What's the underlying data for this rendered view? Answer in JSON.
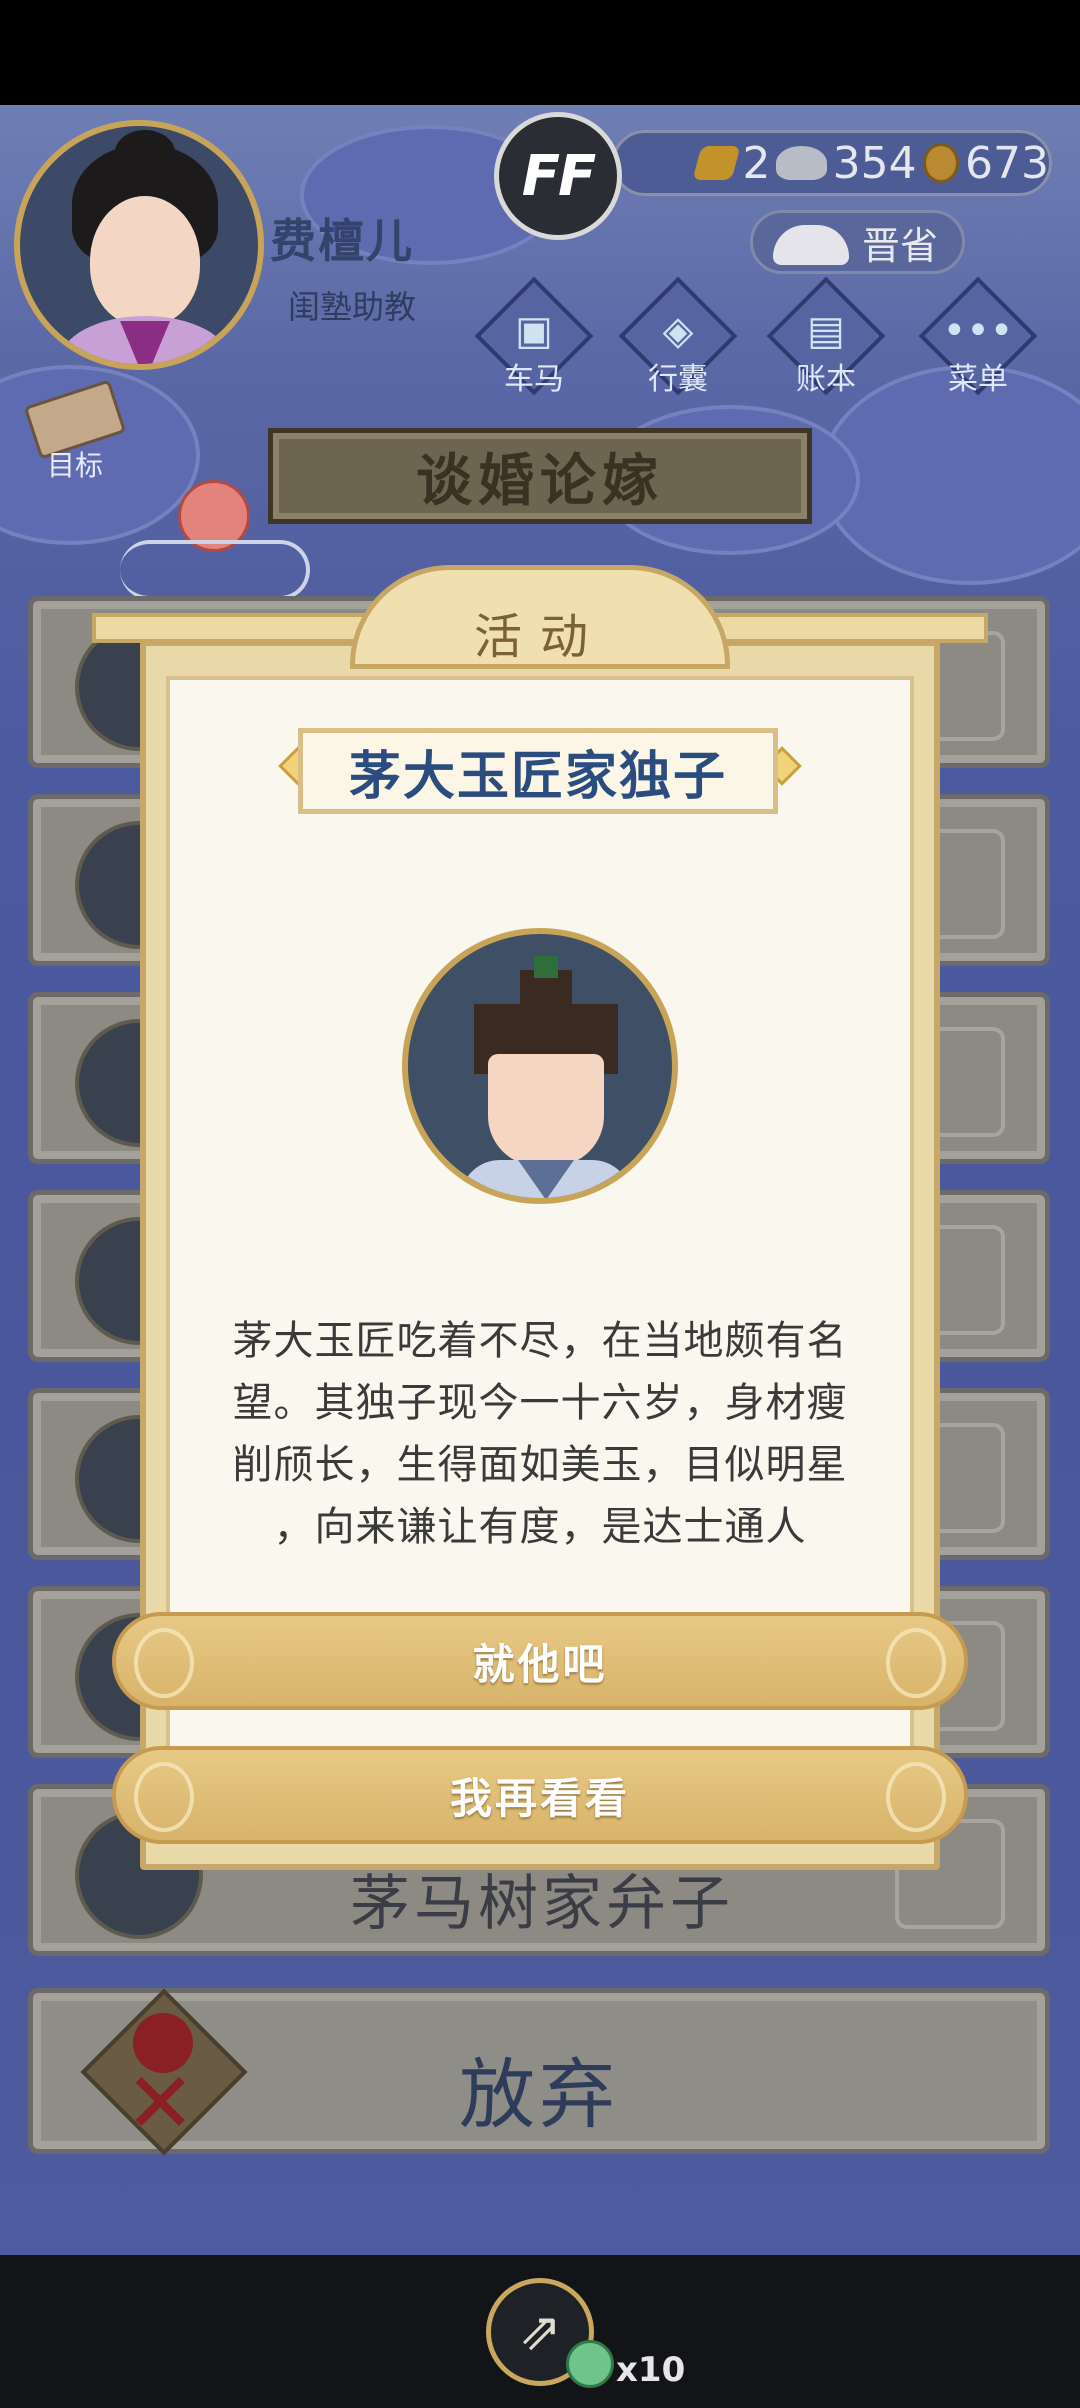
{
  "player": {
    "name": "费檀儿",
    "title": "闺塾助教",
    "badge": "FF"
  },
  "currency": {
    "gold": "2",
    "silver": "354",
    "coins": "673"
  },
  "hud": {
    "jinsheng_label": "晋省",
    "menu": [
      "车马",
      "行囊",
      "账本",
      "菜单"
    ],
    "target_label": "目标"
  },
  "page": {
    "title": "谈婚论嫁"
  },
  "background_list": {
    "partial_text": "茅马树家弁子",
    "give_up_label": "放弃"
  },
  "modal": {
    "header": "活动",
    "character_name": "茅大玉匠家独子",
    "description_lines": [
      "茅大玉匠吃着不尽，在当地颇有名",
      "望。其独子现今一十六岁，身材瘦",
      "削颀长，生得面如美玉，目似明星",
      "，向来谦让有度，是达士通人"
    ],
    "confirm_label": "就他吧",
    "reconsider_label": "我再看看"
  },
  "share": {
    "count": "x10"
  },
  "colors": {
    "accent_gold": "#d8b36a",
    "name_blue": "#2b4c7e",
    "background_blue": "#4c5aa0"
  }
}
